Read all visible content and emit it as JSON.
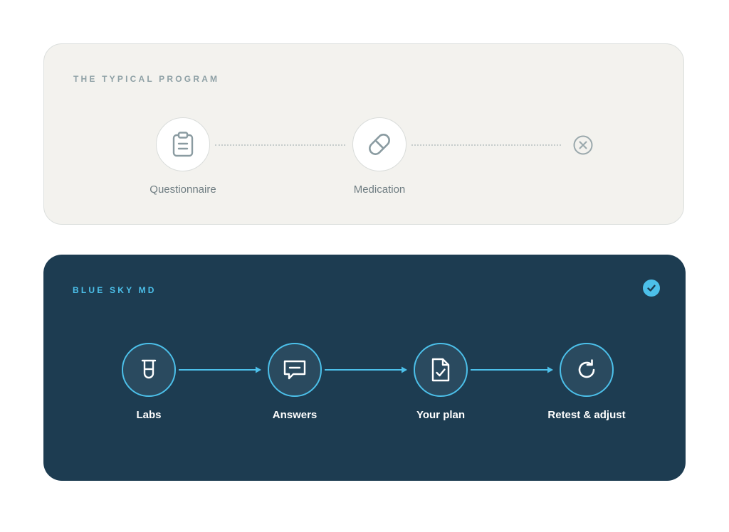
{
  "typical": {
    "eyebrow": "THE TYPICAL PROGRAM",
    "steps": [
      {
        "label": "Questionnaire",
        "icon": "clipboard-icon"
      },
      {
        "label": "Medication",
        "icon": "pill-icon"
      }
    ],
    "end_icon": "x-circle-icon"
  },
  "bluesky": {
    "eyebrow": "BLUE SKY MD",
    "badge_icon": "check-circle-icon",
    "steps": [
      {
        "label": "Labs",
        "icon": "test-tube-icon"
      },
      {
        "label": "Answers",
        "icon": "chat-bubble-icon"
      },
      {
        "label": "Your plan",
        "icon": "document-check-icon"
      },
      {
        "label": "Retest & adjust",
        "icon": "refresh-icon"
      }
    ]
  },
  "colors": {
    "typical_bg": "#f3f2ee",
    "bluesky_bg": "#1d3c51",
    "accent": "#4cc0ea",
    "muted_text": "#8fa1a6"
  }
}
